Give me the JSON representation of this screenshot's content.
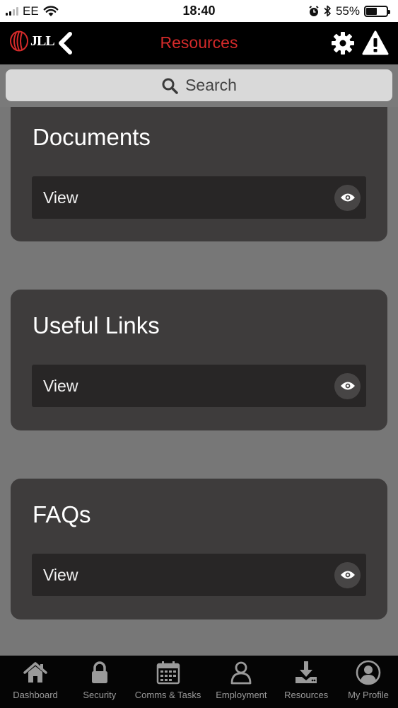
{
  "status_bar": {
    "carrier": "EE",
    "time": "18:40",
    "battery": "55%",
    "battery_level": 0.55,
    "icons": [
      "signal-icon",
      "wifi-icon",
      "alarm-icon",
      "bluetooth-icon",
      "battery-icon"
    ]
  },
  "header": {
    "logo_text": "JLL",
    "title": "Resources",
    "title_color": "#d42a2a",
    "icons": [
      "jll-logo",
      "back-chevron-icon",
      "gear-icon",
      "warning-icon"
    ]
  },
  "search": {
    "placeholder": "Search"
  },
  "cards": [
    {
      "title": "Documents",
      "action_label": "View"
    },
    {
      "title": "Useful Links",
      "action_label": "View"
    },
    {
      "title": "FAQs",
      "action_label": "View"
    }
  ],
  "bottom_nav": {
    "items": [
      {
        "label": "Dashboard",
        "icon": "home-icon"
      },
      {
        "label": "Security",
        "icon": "lock-icon"
      },
      {
        "label": "Comms & Tasks",
        "icon": "calendar-icon"
      },
      {
        "label": "Employment",
        "icon": "person-icon"
      },
      {
        "label": "Resources",
        "icon": "download-icon"
      },
      {
        "label": "My Profile",
        "icon": "profile-icon"
      }
    ]
  },
  "colors": {
    "page_background": "#777777",
    "card_background": "#3e3c3c",
    "row_background": "#282626",
    "header_background": "#000000"
  }
}
